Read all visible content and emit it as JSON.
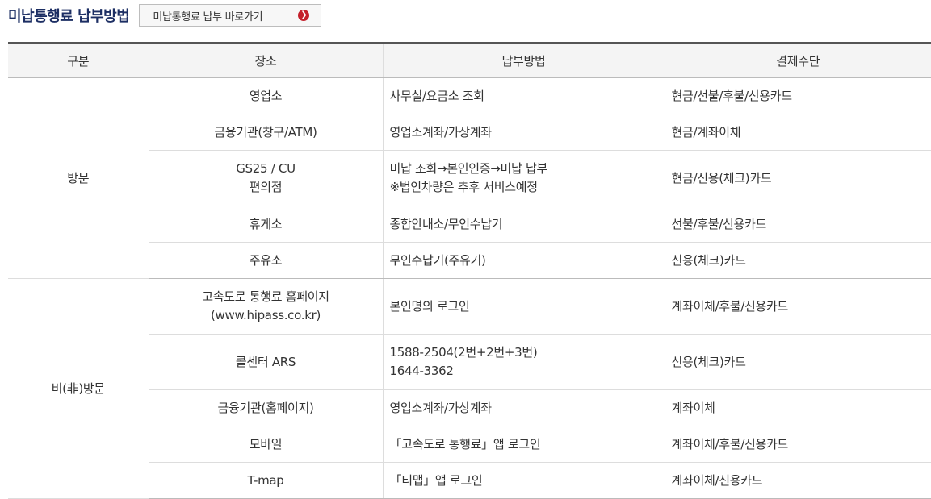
{
  "header": {
    "title": "미납통행료 납부방법",
    "shortcut_label": "미납통행료 납부 바로가기",
    "shortcut_icon": "chevron-right-circle-icon"
  },
  "table": {
    "headers": [
      "구분",
      "장소",
      "납부방법",
      "결제수단"
    ],
    "groups": [
      {
        "name": "방문",
        "rows": [
          {
            "place": [
              "영업소"
            ],
            "method": [
              "사무실/요금소 조회"
            ],
            "payment": "현금/선불/후불/신용카드"
          },
          {
            "place": [
              "금융기관(창구/ATM)"
            ],
            "method": [
              "영업소계좌/가상계좌"
            ],
            "payment": "현금/계좌이체"
          },
          {
            "place": [
              "GS25 / CU",
              "편의점"
            ],
            "method": [
              "미납 조회→본인인증→미납 납부",
              "※법인차량은 추후 서비스예정"
            ],
            "payment": "현금/신용(체크)카드"
          },
          {
            "place": [
              "휴게소"
            ],
            "method": [
              "종합안내소/무인수납기"
            ],
            "payment": "선불/후불/신용카드"
          },
          {
            "place": [
              "주유소"
            ],
            "method": [
              "무인수납기(주유기)"
            ],
            "payment": "신용(체크)카드"
          }
        ]
      },
      {
        "name": "비(非)방문",
        "rows": [
          {
            "place": [
              "고속도로 통행료 홈페이지",
              "(www.hipass.co.kr)"
            ],
            "method": [
              "본인명의 로그인"
            ],
            "payment": "계좌이체/후불/신용카드"
          },
          {
            "place": [
              "콜센터 ARS"
            ],
            "method": [
              "1588-2504(2번+2번+3번)",
              "1644-3362"
            ],
            "payment": "신용(체크)카드"
          },
          {
            "place": [
              "금융기관(홈페이지)"
            ],
            "method": [
              "영업소계좌/가상계좌"
            ],
            "payment": "계좌이체"
          },
          {
            "place": [
              "모바일"
            ],
            "method": [
              "「고속도로 통행료」앱 로그인"
            ],
            "payment": "계좌이체/후불/신용카드"
          },
          {
            "place": [
              "T-map"
            ],
            "method": [
              "「티맵」앱 로그인"
            ],
            "payment": "계좌이체/신용카드"
          }
        ]
      }
    ]
  }
}
